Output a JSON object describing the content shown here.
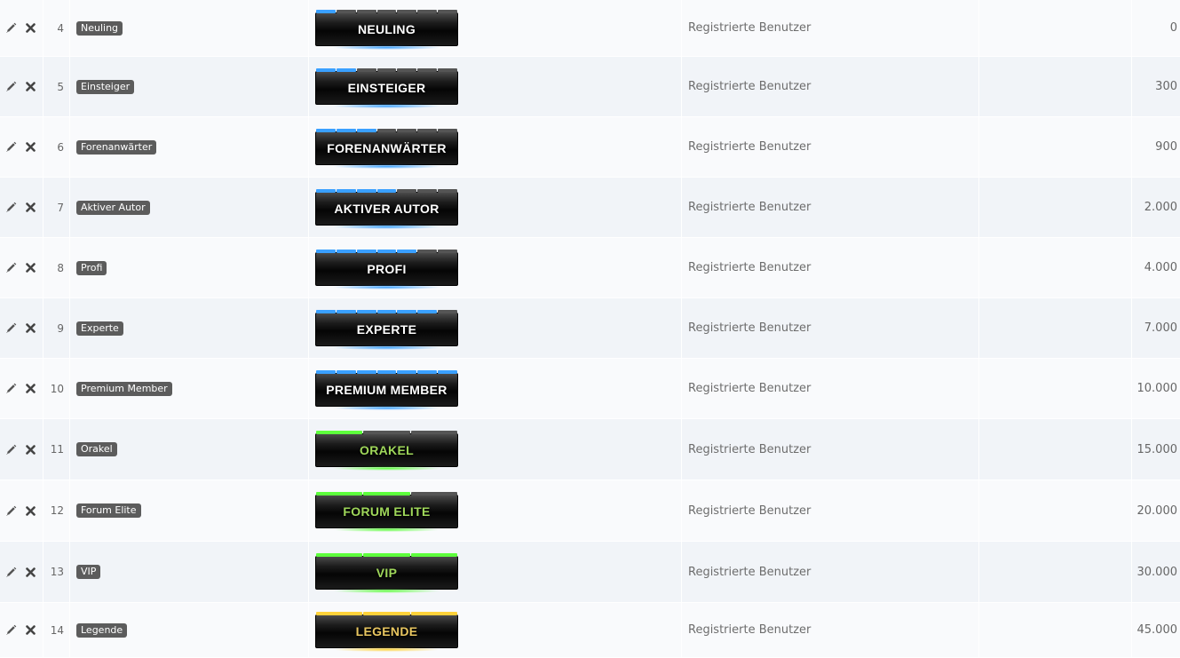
{
  "group_label": "Registrierte Benutzer",
  "colors": {
    "blue": "#3aa0ff",
    "green": "#5dff3c",
    "gold": "#ffd23a",
    "green_text": "#9fd75a",
    "gold_text": "#e8c660"
  },
  "rows": [
    {
      "id": "4",
      "name": "Neuling",
      "rank_title": "NEULING",
      "color": "blue",
      "filled": 1,
      "segments": 7,
      "group": "Registrierte Benutzer",
      "points": "0"
    },
    {
      "id": "5",
      "name": "Einsteiger",
      "rank_title": "EINSTEIGER",
      "color": "blue",
      "filled": 2,
      "segments": 7,
      "group": "Registrierte Benutzer",
      "points": "300"
    },
    {
      "id": "6",
      "name": "Forenanwärter",
      "rank_title": "FORENANWÄRTER",
      "color": "blue",
      "filled": 3,
      "segments": 7,
      "group": "Registrierte Benutzer",
      "points": "900"
    },
    {
      "id": "7",
      "name": "Aktiver Autor",
      "rank_title": "AKTIVER AUTOR",
      "color": "blue",
      "filled": 4,
      "segments": 7,
      "group": "Registrierte Benutzer",
      "points": "2.000"
    },
    {
      "id": "8",
      "name": "Profi",
      "rank_title": "PROFI",
      "color": "blue",
      "filled": 5,
      "segments": 7,
      "group": "Registrierte Benutzer",
      "points": "4.000"
    },
    {
      "id": "9",
      "name": "Experte",
      "rank_title": "EXPERTE",
      "color": "blue",
      "filled": 6,
      "segments": 7,
      "group": "Registrierte Benutzer",
      "points": "7.000"
    },
    {
      "id": "10",
      "name": "Premium Member",
      "rank_title": "PREMIUM MEMBER",
      "color": "blue",
      "filled": 7,
      "segments": 7,
      "group": "Registrierte Benutzer",
      "points": "10.000"
    },
    {
      "id": "11",
      "name": "Orakel",
      "rank_title": "ORAKEL",
      "color": "green",
      "filled": 1,
      "segments": 3,
      "group": "Registrierte Benutzer",
      "points": "15.000"
    },
    {
      "id": "12",
      "name": "Forum Elite",
      "rank_title": "FORUM ELITE",
      "color": "green",
      "filled": 2,
      "segments": 3,
      "group": "Registrierte Benutzer",
      "points": "20.000"
    },
    {
      "id": "13",
      "name": "VIP",
      "rank_title": "VIP",
      "color": "green",
      "filled": 3,
      "segments": 3,
      "group": "Registrierte Benutzer",
      "points": "30.000"
    },
    {
      "id": "14",
      "name": "Legende",
      "rank_title": "LEGENDE",
      "color": "gold",
      "filled": 3,
      "segments": 3,
      "group": "Registrierte Benutzer",
      "points": "45.000"
    }
  ],
  "icons": {
    "edit": "pencil-icon",
    "delete": "close-icon"
  }
}
